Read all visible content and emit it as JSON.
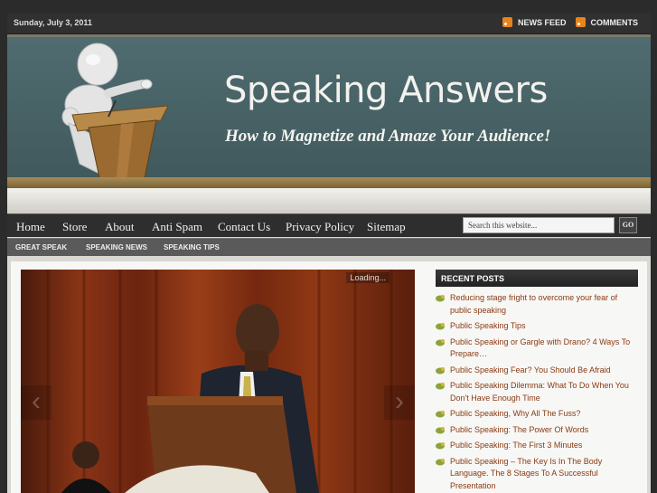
{
  "topbar": {
    "date": "Sunday, July 3, 2011",
    "links": [
      {
        "label": "NEWS FEED",
        "icon": "rss-icon"
      },
      {
        "label": "COMMENTS",
        "icon": "rss-icon"
      }
    ]
  },
  "header": {
    "title": "Speaking Answers",
    "tagline": "How to Magnetize and Amaze Your Audience!"
  },
  "nav": {
    "items": [
      "Home",
      "Store",
      "About",
      "Anti Spam",
      "Contact Us",
      "Privacy Policy",
      "Sitemap"
    ],
    "search_value": "Search this website...",
    "go_label": "GO"
  },
  "subnav": {
    "items": [
      "GREAT SPEAK",
      "SPEAKING NEWS",
      "SPEAKING TIPS"
    ]
  },
  "slider": {
    "loading_text": "Loading...",
    "prev_icon": "chevron-left-icon",
    "next_icon": "chevron-right-icon"
  },
  "sidebar": {
    "heading": "RECENT POSTS",
    "posts": [
      "Reducing stage fright to overcome your fear of public speaking",
      "Public Speaking Tips",
      "Public Speaking or Gargle with Drano? 4 Ways To Prepare…",
      "Public Speaking Fear? You Should Be Afraid",
      "Public Speaking Dilemma: What To Do When You Don't Have Enough Time",
      "Public Speaking, Why All The Fuss?",
      "Public Speaking: The Power Of Words",
      "Public Speaking: The First 3 Minutes",
      "Public Speaking – The Key Is In The Body Language. The 8 Stages To A Successful Presentation"
    ]
  },
  "colors": {
    "accent_link": "#8a3a12",
    "chalkboard": "#4a6468",
    "nav_bg": "#2e2e2e"
  }
}
